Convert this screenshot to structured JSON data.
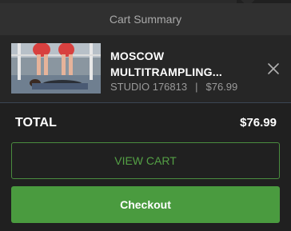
{
  "cart": {
    "header_title": "Cart Summary",
    "item": {
      "title": "MOSCOW MULTITRAMPLING...",
      "studio": "STUDIO 176813",
      "separator": "|",
      "price": "$76.99"
    },
    "total_label": "TOTAL",
    "total_value": "$76.99",
    "view_cart_label": "VIEW CART",
    "checkout_label": "Checkout"
  },
  "colors": {
    "accent_green": "#4a9b3f",
    "view_cart_text": "#54a045",
    "panel_bg": "#202020",
    "header_bg": "#303030"
  },
  "icons": {
    "remove": "close-icon",
    "thumbnail": "product-thumbnail"
  }
}
